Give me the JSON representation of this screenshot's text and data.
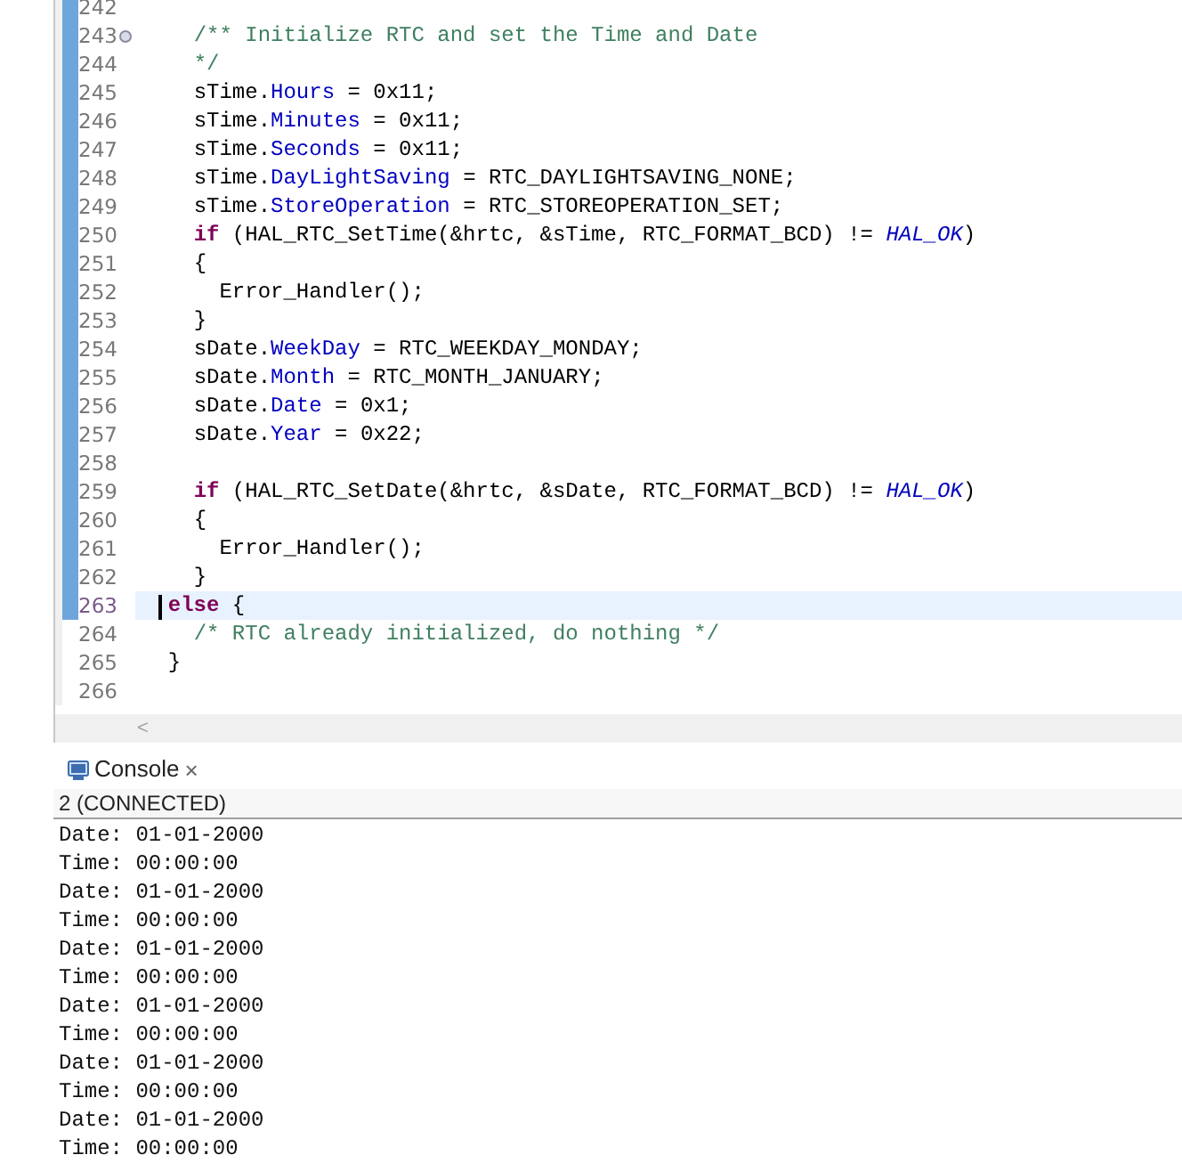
{
  "editor": {
    "lines": [
      {
        "number": "242",
        "changed": true,
        "current": false,
        "foldable": false
      },
      {
        "number": "243",
        "changed": true,
        "current": false,
        "foldable": true,
        "tokens": [
          {
            "kind": "comment",
            "text": "    /** Initialize RTC and set the Time and Date"
          }
        ]
      },
      {
        "number": "244",
        "changed": true,
        "current": false,
        "foldable": false,
        "tokens": [
          {
            "kind": "comment",
            "text": "    */"
          }
        ]
      },
      {
        "number": "245",
        "changed": true,
        "current": false,
        "foldable": false,
        "tokens": [
          {
            "kind": "text",
            "text": "    sTime."
          },
          {
            "kind": "field",
            "text": "Hours"
          },
          {
            "kind": "text",
            "text": " = 0x11;"
          }
        ]
      },
      {
        "number": "246",
        "changed": true,
        "current": false,
        "foldable": false,
        "tokens": [
          {
            "kind": "text",
            "text": "    sTime."
          },
          {
            "kind": "field",
            "text": "Minutes"
          },
          {
            "kind": "text",
            "text": " = 0x11;"
          }
        ]
      },
      {
        "number": "247",
        "changed": true,
        "current": false,
        "foldable": false,
        "tokens": [
          {
            "kind": "text",
            "text": "    sTime."
          },
          {
            "kind": "field",
            "text": "Seconds"
          },
          {
            "kind": "text",
            "text": " = 0x11;"
          }
        ]
      },
      {
        "number": "248",
        "changed": true,
        "current": false,
        "foldable": false,
        "tokens": [
          {
            "kind": "text",
            "text": "    sTime."
          },
          {
            "kind": "field",
            "text": "DayLightSaving"
          },
          {
            "kind": "text",
            "text": " = RTC_DAYLIGHTSAVING_NONE;"
          }
        ]
      },
      {
        "number": "249",
        "changed": true,
        "current": false,
        "foldable": false,
        "tokens": [
          {
            "kind": "text",
            "text": "    sTime."
          },
          {
            "kind": "field",
            "text": "StoreOperation"
          },
          {
            "kind": "text",
            "text": " = RTC_STOREOPERATION_SET;"
          }
        ]
      },
      {
        "number": "250",
        "changed": true,
        "current": false,
        "foldable": false,
        "tokens": [
          {
            "kind": "keyword",
            "text": "    if"
          },
          {
            "kind": "text",
            "text": " (HAL_RTC_SetTime(&hrtc, &sTime, RTC_FORMAT_BCD) != "
          },
          {
            "kind": "constant",
            "text": "HAL_OK"
          },
          {
            "kind": "text",
            "text": ")"
          }
        ]
      },
      {
        "number": "251",
        "changed": true,
        "current": false,
        "foldable": false,
        "tokens": [
          {
            "kind": "text",
            "text": "    {"
          }
        ]
      },
      {
        "number": "252",
        "changed": true,
        "current": false,
        "foldable": false,
        "tokens": [
          {
            "kind": "text",
            "text": "      Error_Handler();"
          }
        ]
      },
      {
        "number": "253",
        "changed": true,
        "current": false,
        "foldable": false,
        "tokens": [
          {
            "kind": "text",
            "text": "    }"
          }
        ]
      },
      {
        "number": "254",
        "changed": true,
        "current": false,
        "foldable": false,
        "tokens": [
          {
            "kind": "text",
            "text": "    sDate."
          },
          {
            "kind": "field",
            "text": "WeekDay"
          },
          {
            "kind": "text",
            "text": " = RTC_WEEKDAY_MONDAY;"
          }
        ]
      },
      {
        "number": "255",
        "changed": true,
        "current": false,
        "foldable": false,
        "tokens": [
          {
            "kind": "text",
            "text": "    sDate."
          },
          {
            "kind": "field",
            "text": "Month"
          },
          {
            "kind": "text",
            "text": " = RTC_MONTH_JANUARY;"
          }
        ]
      },
      {
        "number": "256",
        "changed": true,
        "current": false,
        "foldable": false,
        "tokens": [
          {
            "kind": "text",
            "text": "    sDate."
          },
          {
            "kind": "field",
            "text": "Date"
          },
          {
            "kind": "text",
            "text": " = 0x1;"
          }
        ]
      },
      {
        "number": "257",
        "changed": true,
        "current": false,
        "foldable": false,
        "tokens": [
          {
            "kind": "text",
            "text": "    sDate."
          },
          {
            "kind": "field",
            "text": "Year"
          },
          {
            "kind": "text",
            "text": " = 0x22;"
          }
        ]
      },
      {
        "number": "258",
        "changed": true,
        "current": false,
        "foldable": false
      },
      {
        "number": "259",
        "changed": true,
        "current": false,
        "foldable": false,
        "tokens": [
          {
            "kind": "keyword",
            "text": "    if"
          },
          {
            "kind": "text",
            "text": " (HAL_RTC_SetDate(&hrtc, &sDate, RTC_FORMAT_BCD) != "
          },
          {
            "kind": "constant",
            "text": "HAL_OK"
          },
          {
            "kind": "text",
            "text": ")"
          }
        ]
      },
      {
        "number": "260",
        "changed": true,
        "current": false,
        "foldable": false,
        "tokens": [
          {
            "kind": "text",
            "text": "    {"
          }
        ]
      },
      {
        "number": "261",
        "changed": true,
        "current": false,
        "foldable": false,
        "tokens": [
          {
            "kind": "text",
            "text": "      Error_Handler();"
          }
        ]
      },
      {
        "number": "262",
        "changed": true,
        "current": false,
        "foldable": false,
        "tokens": [
          {
            "kind": "text",
            "text": "    }"
          }
        ]
      },
      {
        "number": "263",
        "changed": true,
        "current": true,
        "foldable": false,
        "tokens": [
          {
            "kind": "keyword",
            "text": "  else"
          },
          {
            "kind": "text",
            "text": " {"
          }
        ]
      },
      {
        "number": "264",
        "changed": false,
        "current": false,
        "foldable": false,
        "tokens": [
          {
            "kind": "comment",
            "text": "    /* RTC already initialized, do nothing */"
          }
        ]
      },
      {
        "number": "265",
        "changed": false,
        "current": false,
        "foldable": false,
        "tokens": [
          {
            "kind": "text",
            "text": "  }"
          }
        ]
      },
      {
        "number": "266",
        "changed": false,
        "current": false,
        "foldable": false
      }
    ],
    "scroll_left": "<"
  },
  "console": {
    "tab": {
      "label": "Console",
      "close": "×",
      "selected": true
    },
    "session": "2 (CONNECTED)",
    "output": [
      "Date: 01-01-2000",
      "Time: 00:00:00",
      "Date: 01-01-2000",
      "Time: 00:00:00",
      "Date: 01-01-2000",
      "Time: 00:00:00",
      "Date: 01-01-2000",
      "Time: 00:00:00",
      "Date: 01-01-2000",
      "Time: 00:00:00",
      "Date: 01-01-2000",
      "Time: 00:00:00"
    ]
  }
}
